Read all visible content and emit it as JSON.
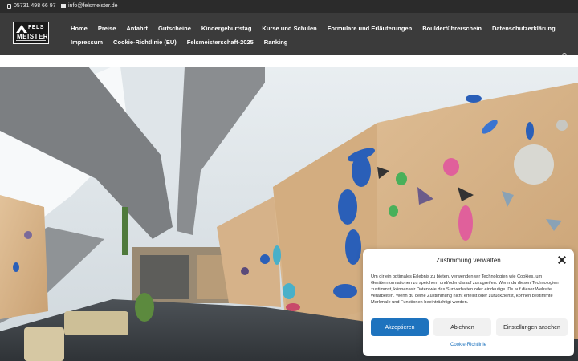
{
  "topbar": {
    "phone": "05731 498 66 97",
    "email": "info@felsmeister.de"
  },
  "logo": {
    "line1": "FELS",
    "line2": "MEISTER"
  },
  "nav": {
    "row1": [
      "Home",
      "Preise",
      "Anfahrt",
      "Gutscheine",
      "Kindergeburtstag",
      "Kurse und Schulen",
      "Formulare und Erläuterungen",
      "Boulderführerschein",
      "Datenschutzerklärung"
    ],
    "row2": [
      "Impressum",
      "Cookie-Richtlinie (EU)",
      "Felsmeisterschaft-2025",
      "Ranking"
    ]
  },
  "consent": {
    "title": "Zustimmung verwalten",
    "body": "Um dir ein optimales Erlebnis zu bieten, verwenden wir Technologien wie Cookies, um Geräteinformationen zu speichern und/oder darauf zuzugreifen. Wenn du diesen Technologien zustimmst, können wir Daten wie das Surfverhalten oder eindeutige IDs auf dieser Website verarbeiten. Wenn du deine Zustimmung nicht erteilst oder zurückziehst, können bestimmte Merkmale und Funktionen beeinträchtigt werden.",
    "accept": "Akzeptieren",
    "deny": "Ablehnen",
    "settings": "Einstellungen ansehen",
    "policy_link": "Cookie-Richtlinie"
  },
  "colors": {
    "topbar_bg": "#2b2b2b",
    "header_bg": "#3b3b3b",
    "accent": "#1e73be"
  }
}
